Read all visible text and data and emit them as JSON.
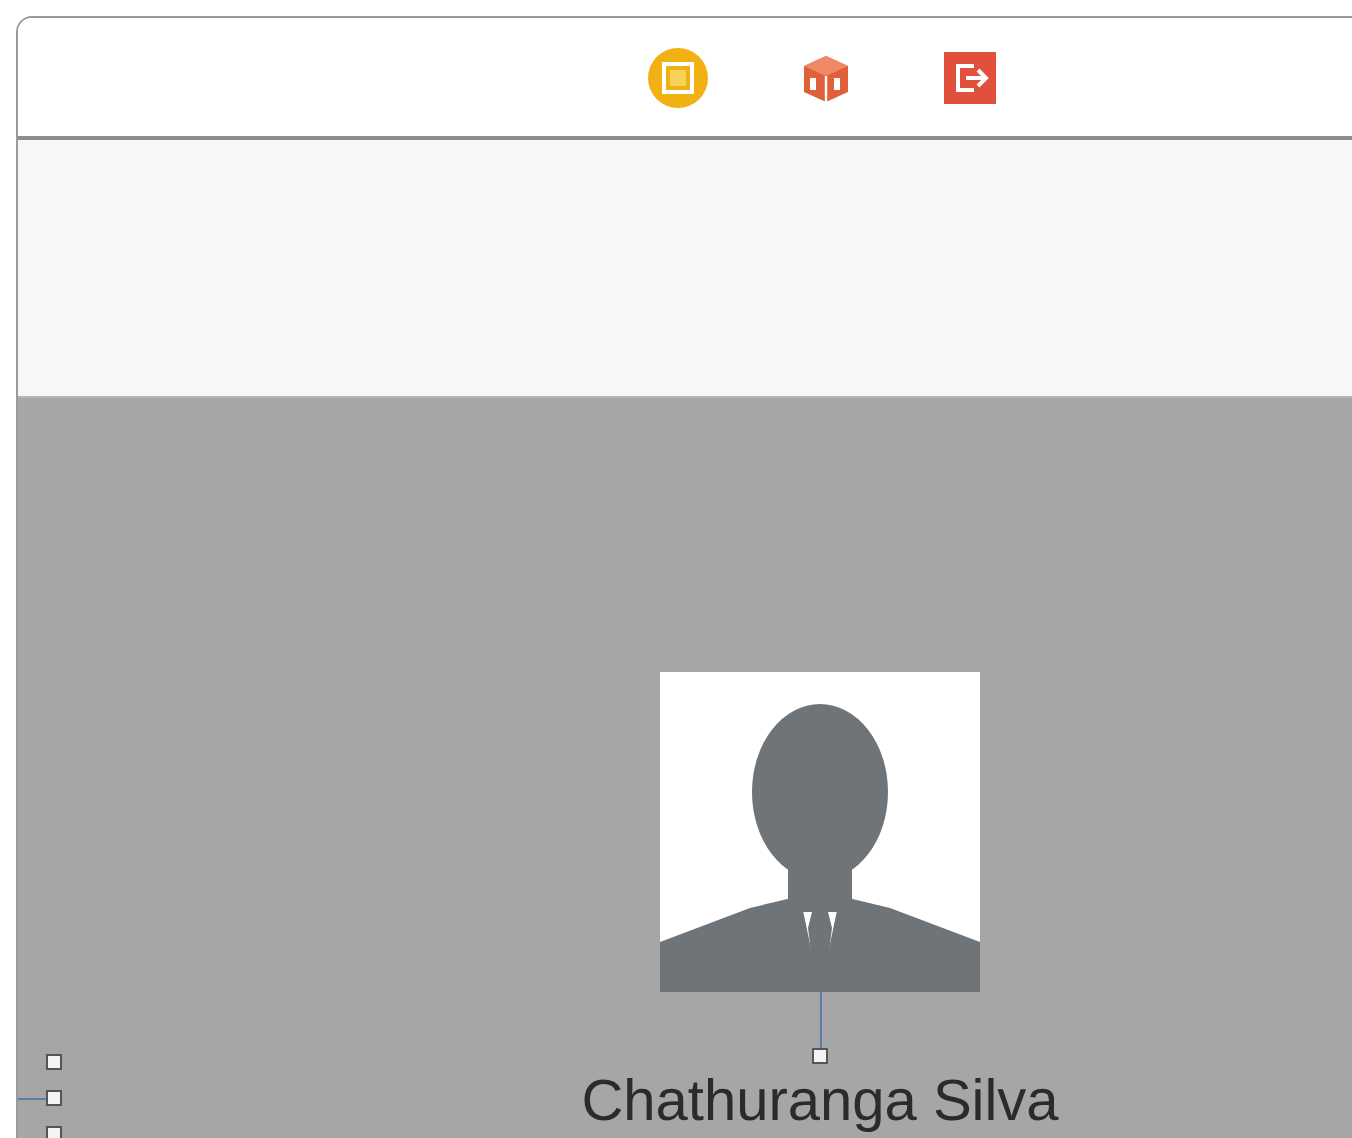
{
  "name_label": {
    "text": "Chathuranga Silva"
  }
}
